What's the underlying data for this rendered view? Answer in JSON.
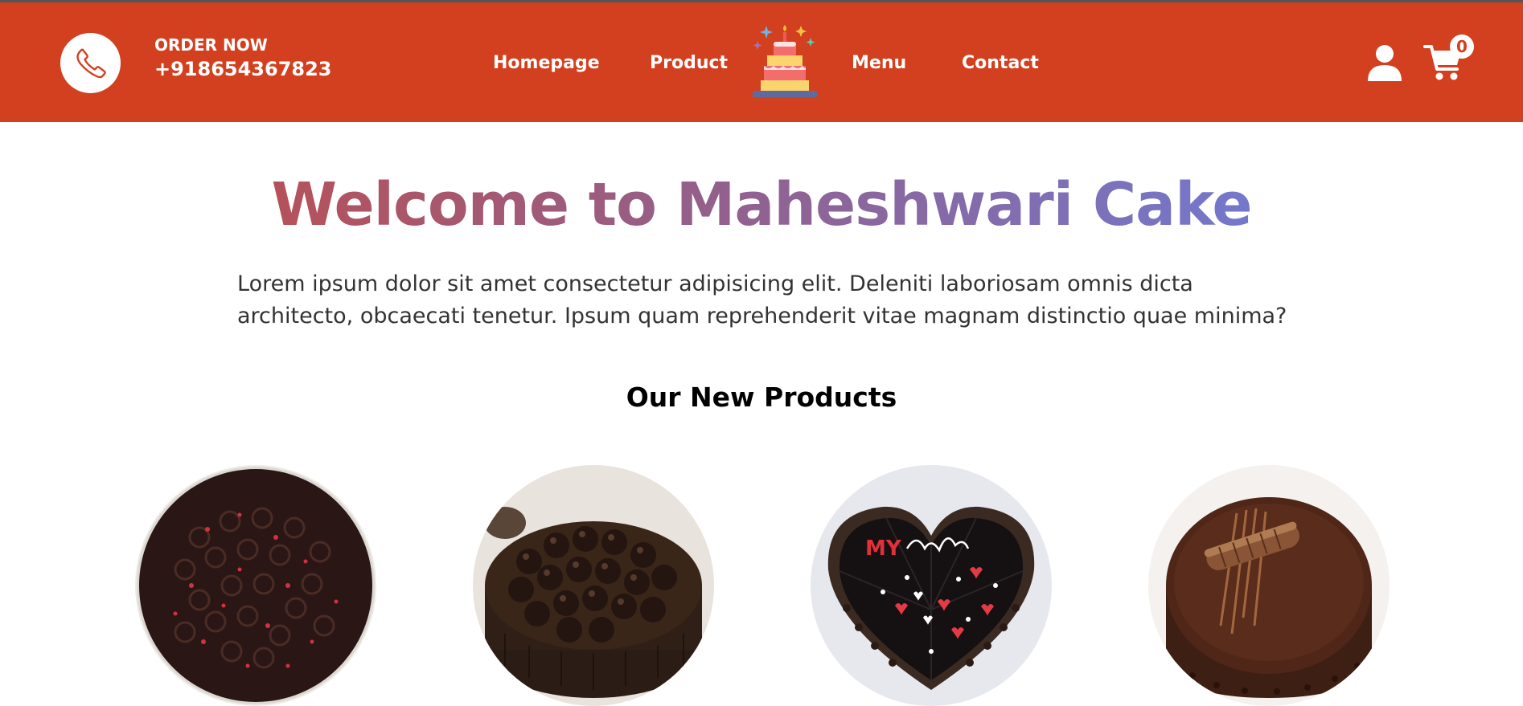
{
  "header": {
    "order_label": "ORDER NOW",
    "phone": "+918654367823",
    "nav": [
      "Homepage",
      "Product",
      "Menu",
      "Contact"
    ],
    "cart_count": "0",
    "icons": {
      "phone": "phone-icon",
      "logo": "cake-logo",
      "user": "user-icon",
      "cart": "cart-icon"
    },
    "colors": {
      "nav_bg": "#d2401f",
      "title_gradient_start": "#b5525a",
      "title_gradient_end": "#7478cc"
    }
  },
  "hero": {
    "title": "Welcome to Maheshwari Cake",
    "text": "Lorem ipsum dolor sit amet consectetur adipisicing elit. Deleniti laboriosam omnis dicta architecto, obcaecati tenetur. Ipsum quam reprehenderit vitae magnam distinctio quae minima?"
  },
  "products": {
    "heading": "Our New Products",
    "items": [
      {
        "kind": "chocolate rosette cake"
      },
      {
        "kind": "chocolate truffle ball cake"
      },
      {
        "kind": "heart pinata cake",
        "inscription": "MY"
      },
      {
        "kind": "chocolate ganache cake"
      }
    ]
  }
}
